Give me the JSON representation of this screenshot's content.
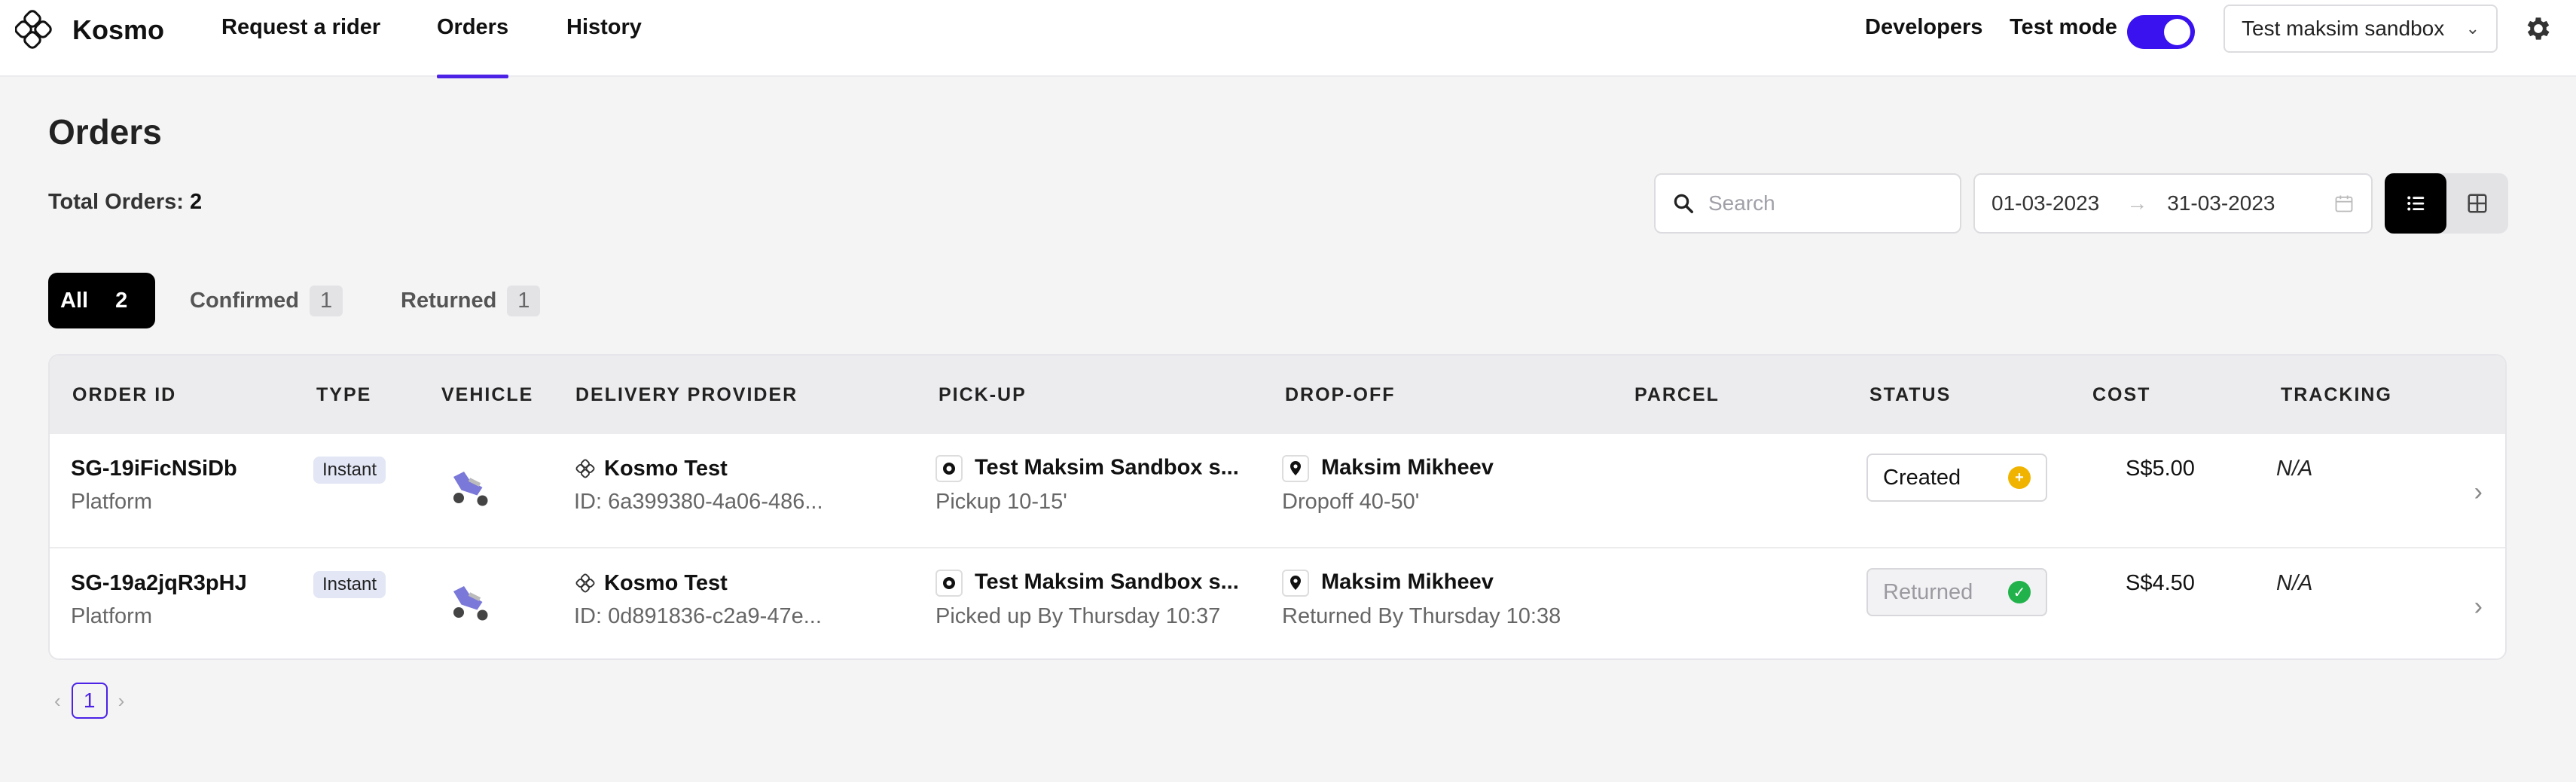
{
  "app": {
    "brand": "Kosmo"
  },
  "nav": [
    {
      "label": "Request a rider",
      "active": false
    },
    {
      "label": "Orders",
      "active": true
    },
    {
      "label": "History",
      "active": false
    }
  ],
  "header": {
    "developers": "Developers",
    "test_mode_label": "Test mode",
    "test_mode_on": true,
    "account": "Test maksim sandbox"
  },
  "page": {
    "title": "Orders",
    "total_label": "Total Orders:",
    "total_value": "2"
  },
  "search": {
    "placeholder": "Search",
    "value": ""
  },
  "date_range": {
    "from": "01-03-2023",
    "to": "31-03-2023",
    "arrow": "→"
  },
  "filters": [
    {
      "label": "All",
      "count": "2",
      "active": true
    },
    {
      "label": "Confirmed",
      "count": "1",
      "active": false
    },
    {
      "label": "Returned",
      "count": "1",
      "active": false
    }
  ],
  "table": {
    "columns": [
      "ORDER ID",
      "TYPE",
      "VEHICLE",
      "DELIVERY PROVIDER",
      "PICK-UP",
      "DROP-OFF",
      "PARCEL",
      "STATUS",
      "COST",
      "TRACKING"
    ],
    "rows": [
      {
        "order_id": "SG-19iFicNSiDb",
        "source": "Platform",
        "type": "Instant",
        "provider": "Kosmo Test",
        "provider_id": "ID: 6a399380-4a06-486...",
        "pickup": "Test Maksim Sandbox s...",
        "pickup_sub": "Pickup 10-15'",
        "dropoff": "Maksim Mikheev",
        "dropoff_sub": "Dropoff 40-50'",
        "parcel": "",
        "status": "Created",
        "status_color": "#f0b400",
        "cost": "S$5.00",
        "tracking": "N/A"
      },
      {
        "order_id": "SG-19a2jqR3pHJ",
        "source": "Platform",
        "type": "Instant",
        "provider": "Kosmo Test",
        "provider_id": "ID: 0d891836-c2a9-47e...",
        "pickup": "Test Maksim Sandbox s...",
        "pickup_sub": "Picked up By Thursday 10:37",
        "dropoff": "Maksim Mikheev",
        "dropoff_sub": "Returned By Thursday 10:38",
        "parcel": "",
        "status": "Returned",
        "status_color": "#22b24c",
        "cost": "S$4.50",
        "tracking": "N/A"
      }
    ]
  },
  "pagination": {
    "current": "1",
    "prev": "‹",
    "next": "›"
  },
  "colors": {
    "accent": "#3a12f0",
    "brand_underline": "#4b22e6"
  }
}
